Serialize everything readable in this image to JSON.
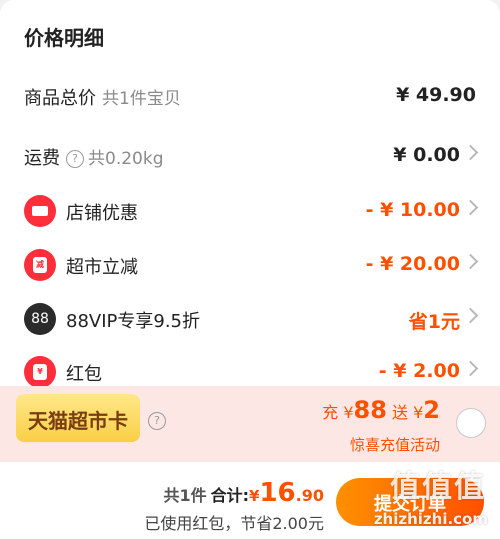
{
  "header": {
    "title": "价格明细"
  },
  "rows": {
    "total": {
      "label": "商品总价",
      "sub": "共1件宝贝",
      "value": "¥ 49.90"
    },
    "shipping": {
      "label": "运费",
      "sub": "共0.20kg",
      "value": "¥ 0.00"
    },
    "shop_discount": {
      "label": "店铺优惠",
      "value": "- ¥ 10.00"
    },
    "market_discount": {
      "label": "超市立减",
      "value": "- ¥ 20.00",
      "icon_text": "减"
    },
    "vip": {
      "label": "88VIP专享9.5折",
      "value": "省1元",
      "icon_text": "88"
    },
    "redpacket": {
      "label": "红包",
      "value": "- ¥ 2.00",
      "icon_text": "¥"
    }
  },
  "promo": {
    "card_label": "天猫超市卡",
    "charge_prefix": "充",
    "charge_amount": "88",
    "gift_prefix": "送",
    "gift_amount": "2",
    "currency": "¥",
    "subtitle": "惊喜充值活动"
  },
  "footer": {
    "count": "共1件",
    "total_label": "合计:",
    "currency": "¥",
    "total_int": "16",
    "total_dec": ".90",
    "saved_text": "已使用红包，节省2.00元",
    "submit_label": "提交订单",
    "watermark": "值值值",
    "watermark_url": "zhizhizhi.com"
  },
  "colors": {
    "accent": "#ff5000",
    "icon_red": "#ff2e3a",
    "promo_bg": "#fde7e5",
    "card_gold": "#f9cf45"
  }
}
